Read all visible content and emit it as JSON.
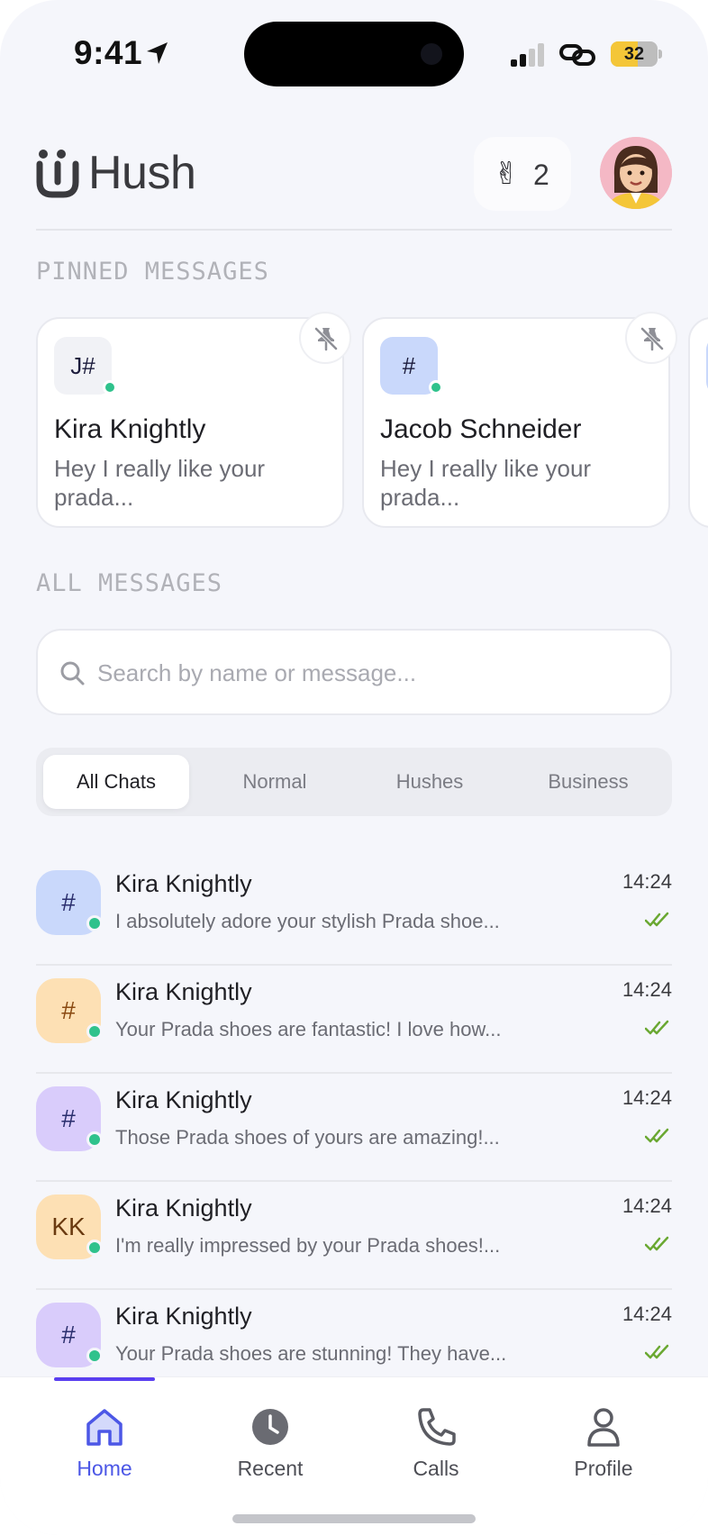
{
  "status_bar": {
    "time": "9:41",
    "battery": "32"
  },
  "header": {
    "app_name": "Hush",
    "wave_emoji": "✌",
    "wave_count": "2"
  },
  "pinned": {
    "section_label": "PINNED MESSAGES",
    "cards": [
      {
        "chip": "J#",
        "chip_color": "#f1f2f6",
        "name": "Kira Knightly",
        "preview": "Hey I really like your prada..."
      },
      {
        "chip": "#",
        "chip_color": "#c9d8fb",
        "name": "Jacob Schneider",
        "preview": "Hey I really like your prada..."
      }
    ]
  },
  "all_messages": {
    "section_label": "ALL MESSAGES",
    "search_placeholder": "Search by name or message..."
  },
  "tabs": [
    {
      "label": "All Chats",
      "active": true
    },
    {
      "label": "Normal",
      "active": false
    },
    {
      "label": "Hushes",
      "active": false
    },
    {
      "label": "Business",
      "active": false
    }
  ],
  "chats": [
    {
      "avatar": "#",
      "avatar_bg": "#c9d8fb",
      "avatar_color": "#2b2f6e",
      "name": "Kira Knightly",
      "message": "I absolutely adore your stylish Prada shoe...",
      "time": "14:24"
    },
    {
      "avatar": "#",
      "avatar_bg": "#fde0b4",
      "avatar_color": "#8a4a12",
      "name": "Kira Knightly",
      "message": "Your Prada shoes are fantastic! I love how...",
      "time": "14:24"
    },
    {
      "avatar": "#",
      "avatar_bg": "#d9ccfb",
      "avatar_color": "#2b2f6e",
      "name": "Kira Knightly",
      "message": "Those Prada shoes of yours are amazing!...",
      "time": "14:24"
    },
    {
      "avatar": "KK",
      "avatar_bg": "#fde0b4",
      "avatar_color": "#6a3a10",
      "name": "Kira Knightly",
      "message": "I'm really impressed by your Prada shoes!...",
      "time": "14:24"
    },
    {
      "avatar": "#",
      "avatar_bg": "#d9ccfb",
      "avatar_color": "#2b2f6e",
      "name": "Kira Knightly",
      "message": "Your Prada shoes are stunning! They have...",
      "time": "14:24"
    }
  ],
  "nav": {
    "home": "Home",
    "recent": "Recent",
    "calls": "Calls",
    "profile": "Profile"
  },
  "colors": {
    "accent": "#4c57e6",
    "online": "#2fc28c",
    "read_check": "#6aa832"
  }
}
